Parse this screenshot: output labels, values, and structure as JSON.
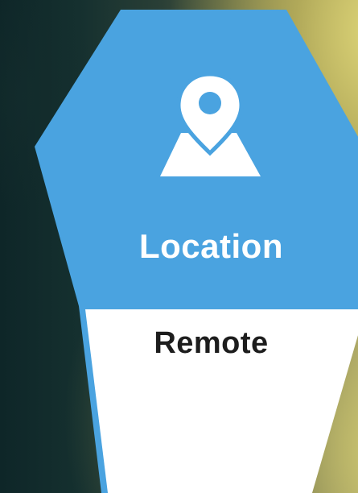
{
  "card": {
    "title": "Location",
    "value": "Remote",
    "icon": "map-location-pin-icon"
  },
  "colors": {
    "header_blue": "#4aa3e0",
    "value_background": "#ffffff",
    "title_text": "#ffffff",
    "value_text": "#1d1d1d"
  }
}
